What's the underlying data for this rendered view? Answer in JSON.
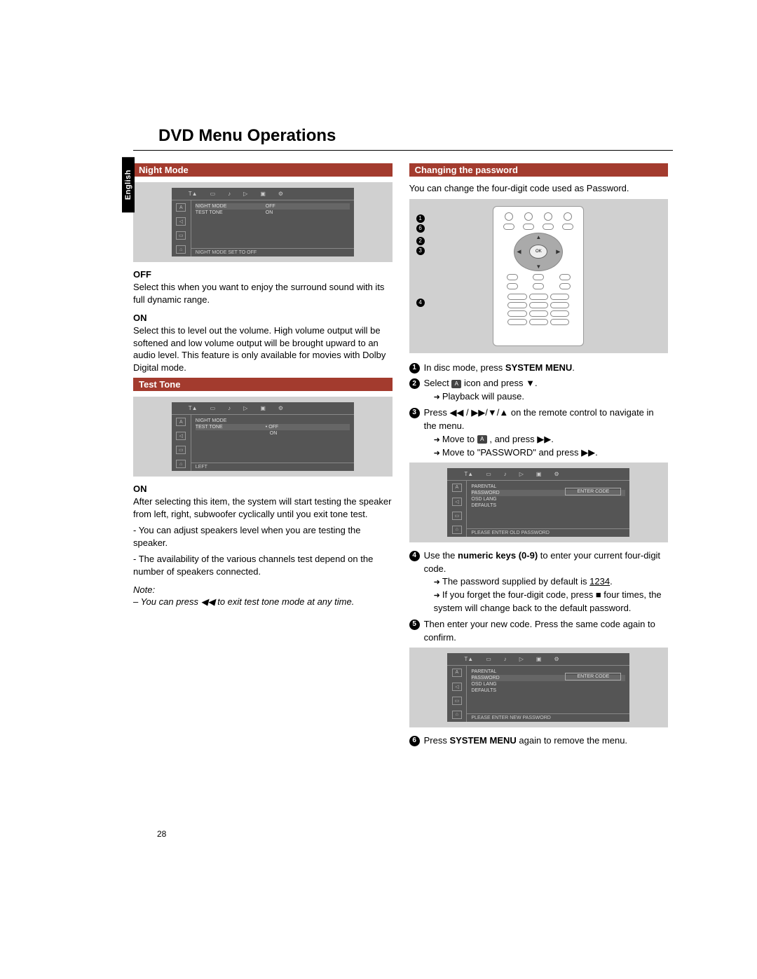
{
  "lang_tab": "English",
  "page_title": "DVD Menu Operations",
  "page_number": "28",
  "left": {
    "section1_title": "Night Mode",
    "osd1": {
      "rows": [
        {
          "label": "NIGHT MODE",
          "opt1": "OFF",
          "opt2": ""
        },
        {
          "label": "TEST TONE",
          "opt1": "ON",
          "opt2": ""
        }
      ],
      "status": "NIGHT MODE SET TO OFF"
    },
    "off_title": "OFF",
    "off_text": "Select this when you want to enjoy the surround sound with its full dynamic range.",
    "on_title": "ON",
    "on_text": "Select this to level out the volume. High volume output will be softened and low volume output will be brought upward to an audio level. This feature is only available for movies with Dolby Digital mode.",
    "section2_title": "Test Tone",
    "osd2": {
      "rows": [
        {
          "label": "NIGHT MODE",
          "opt1": "",
          "opt2": ""
        },
        {
          "label": "TEST TONE",
          "opt1": "OFF",
          "opt2": "ON"
        }
      ],
      "status": "LEFT"
    },
    "on2_title": "ON",
    "on2_p1": "After selecting this item, the system will start testing the speaker from left, right, subwoofer cyclically until you exit tone test.",
    "on2_p2": "- You can adjust speakers level when you are testing the speaker.",
    "on2_p3": "- The availability of the various channels test depend on the number of speakers connected.",
    "note_label": "Note:",
    "note_text_pre": "– You can press ",
    "note_text_post": " to exit test tone mode at any time."
  },
  "right": {
    "section_title": "Changing the password",
    "intro": "You can change the four-digit code used as Password.",
    "remote_ok": "OK",
    "steps": {
      "s1_pre": "In disc mode, press ",
      "s1_bold": "SYSTEM MENU",
      "s1_post": ".",
      "s2_pre": "Select ",
      "s2_post": " icon and press ▼.",
      "s2_sub": "Playback will pause.",
      "s3_pre": "Press ",
      "s3_sym": "◀◀ / ▶▶/▼/▲",
      "s3_post": " on the remote control to navigate in the menu.",
      "s3_sub1_pre": "Move to ",
      "s3_sub1_post": " , and press ▶▶.",
      "s3_sub2": "Move to \"PASSWORD\" and press ▶▶.",
      "s4_pre": "Use the ",
      "s4_bold": "numeric keys (0-9)",
      "s4_post": " to enter your current four-digit code.",
      "s4_sub1_pre": "The password supplied by default is ",
      "s4_sub1_code": "1234",
      "s4_sub1_post": ".",
      "s4_sub2": "If you forget the four-digit code, press ■ four times, the system will change back to the default password.",
      "s5": "Then enter your new code. Press the same code again to confirm.",
      "s6_pre": "Press ",
      "s6_bold": "SYSTEM MENU",
      "s6_post": " again to remove the menu."
    },
    "osd_password": {
      "items": [
        "PARENTAL",
        "PASSWORD",
        "OSD LANG",
        "DEFAULTS"
      ],
      "box": "ENTER CODE",
      "status_old": "PLEASE ENTER OLD PASSWORD",
      "status_new": "PLEASE ENTER NEW PASSWORD"
    }
  }
}
